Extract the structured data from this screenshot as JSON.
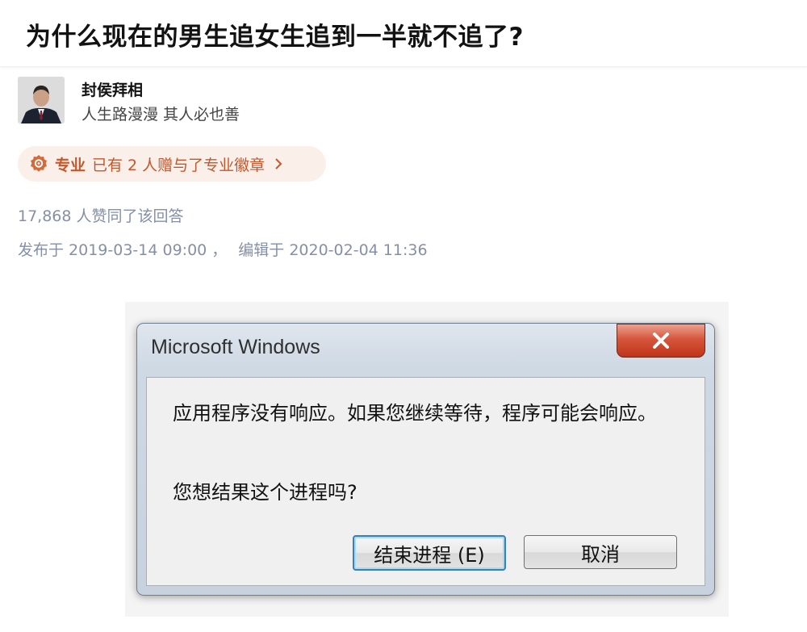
{
  "question": {
    "title": "为什么现在的男生追女生追到一半就不追了?"
  },
  "author": {
    "name": "封侯拜相",
    "bio": "人生路漫漫 其人必也善"
  },
  "badge": {
    "strong": "专业",
    "text": "已有 2 人赠与了专业徽章",
    "accent_color": "#c2582d",
    "icon": "badge-icon"
  },
  "answer_meta": {
    "votes": "17,868 人赞同了该回答",
    "published": "发布于 2019-03-14 09:00",
    "separator": "，",
    "edited": "编辑于 2020-02-04 11:36"
  },
  "dialog": {
    "title": "Microsoft Windows",
    "message": "应用程序没有响应。如果您继续等待，程序可能会响应。",
    "question": "您想结果这个进程吗?",
    "primary_button": "结束进程 (E)",
    "secondary_button": "取消"
  }
}
